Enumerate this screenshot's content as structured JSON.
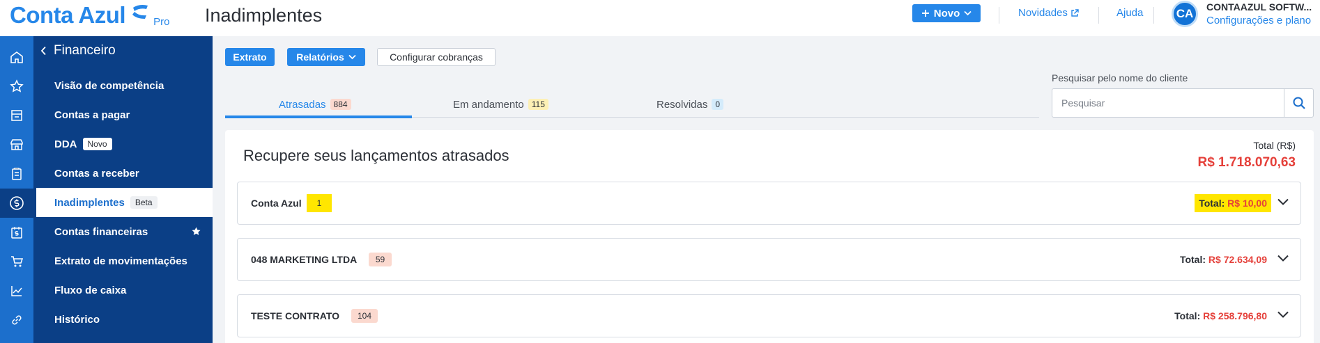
{
  "header": {
    "logo_text": "Conta Azul",
    "logo_pro": "Pro",
    "page_title": "Inadimplentes",
    "new_button_label": "Novo",
    "news_link": "Novidades",
    "help_link": "Ajuda",
    "avatar_initials": "CA",
    "account_name": "CONTAAZUL SOFTW...",
    "account_sub": "Configurações e plano"
  },
  "rail": {
    "icons": [
      "home-icon",
      "star-icon",
      "store-icon",
      "shop-icon",
      "clipboard-icon",
      "dollar-circle-icon",
      "calendar-dollar-icon",
      "cart-icon",
      "line-chart-icon",
      "link-icon"
    ],
    "active_index": 5
  },
  "sidebar": {
    "section_title": "Financeiro",
    "items": [
      {
        "label": "Visão de competência",
        "badge": ""
      },
      {
        "label": "Contas a pagar",
        "badge": ""
      },
      {
        "label": "DDA",
        "badge": "Novo"
      },
      {
        "label": "Contas a receber",
        "badge": ""
      },
      {
        "label": "Inadimplentes",
        "badge": "Beta"
      },
      {
        "label": "Contas financeiras",
        "badge": ""
      },
      {
        "label": "Extrato de movimentações",
        "badge": ""
      },
      {
        "label": "Fluxo de caixa",
        "badge": ""
      },
      {
        "label": "Histórico",
        "badge": ""
      }
    ],
    "active_index": 4,
    "starred_index": 5
  },
  "toolbar": {
    "extrato_label": "Extrato",
    "relatorios_label": "Relatórios",
    "configurar_label": "Configurar cobranças"
  },
  "tabs": [
    {
      "label": "Atrasadas",
      "count": "884"
    },
    {
      "label": "Em andamento",
      "count": "115"
    },
    {
      "label": "Resolvidas",
      "count": "0"
    }
  ],
  "search": {
    "label": "Pesquisar pelo nome do cliente",
    "placeholder": "Pesquisar"
  },
  "card": {
    "title": "Recupere seus lançamentos atrasados",
    "total_label": "Total (R$)",
    "total_value": "R$ 1.718.070,63"
  },
  "rows": [
    {
      "name": "Conta Azul",
      "count": "1",
      "total_label": "Total:",
      "total_value": "R$ 10,00",
      "highlighted": true
    },
    {
      "name": "048 MARKETING LTDA",
      "count": "59",
      "total_label": "Total:",
      "total_value": "R$ 72.634,09",
      "highlighted": false
    },
    {
      "name": "TESTE CONTRATO",
      "count": "104",
      "total_label": "Total:",
      "total_value": "R$ 258.796,80",
      "highlighted": false
    }
  ],
  "colors": {
    "brand_blue": "#2687e9",
    "sidebar_navy": "#0b3f86",
    "rail_blue": "#1c6fcc",
    "amount_red": "#e5403a",
    "highlight_yellow": "#ffe600",
    "tab_count_red_bg": "#fbd9cf",
    "tab_count_yellow_bg": "#fdf0b5",
    "tab_count_blue_bg": "#d4ebfb"
  }
}
